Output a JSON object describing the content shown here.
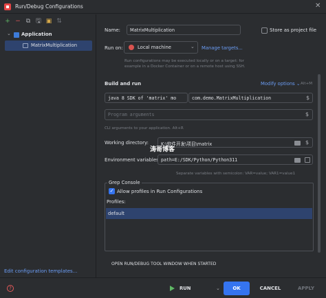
{
  "window": {
    "title": "Run/Debug Configurations",
    "close_glyph": "✕"
  },
  "toolbar": {
    "add": "+",
    "remove": "−",
    "copy": "⧉",
    "save": "🖫",
    "folder": "▣",
    "sort": "⇅"
  },
  "tree": {
    "group_label": "Application",
    "child_label": "MatrixMultiplication"
  },
  "left_footer": {
    "edit_templates": "Edit configuration templates..."
  },
  "form": {
    "name_label": "Name:",
    "name_value": "MatrixMultiplication",
    "store_as_file": "Store as project file",
    "run_on_label": "Run on:",
    "run_on_value": "Local machine",
    "manage_targets": "Manage targets...",
    "run_on_hint_1": "Run configurations may be executed locally or on a target: for",
    "run_on_hint_2": "example in a Docker Container or on a remote host using SSH.",
    "build_and_run": "Build and run",
    "modify_options": "Modify options ⌄",
    "modify_shortcut": "Alt+M",
    "jdk_value": "java 8 SDK of 'matrix' mo",
    "main_class": "com.demo.MatrixMultiplication",
    "program_args_placeholder": "Program arguments",
    "cli_hint": "CLI arguments to your application. Alt+R",
    "working_dir_label": "Working directory:",
    "working_dir_value": "K:\\软件开发\\项目\\matrix",
    "env_label": "Environment variables:",
    "env_value": "path=E:/SDK/Python/Python311",
    "env_hint": "Separate variables with semicolon: VAR=value; VAR1=value1",
    "grep_console": "Grep Console",
    "allow_profiles": "Allow profiles in Run Configurations",
    "profiles_label": "Profiles:",
    "profile_default": "default",
    "open_tool_window": "OPEN RUN/DEBUG TOOL WINDOW WHEN STARTED"
  },
  "watermark": "涛哥博客",
  "buttons": {
    "help": "?",
    "run": "RUN",
    "ok": "OK",
    "cancel": "CANCEL",
    "apply": "APPLY"
  },
  "colors": {
    "accent": "#3574f0",
    "link": "#6b9df5",
    "selection": "#2e436e",
    "background": "#2b2d30"
  },
  "icons": {
    "run": "play-icon",
    "machine": "local-machine-icon",
    "folder": "folder-icon",
    "help": "help-icon",
    "app": "application-icon"
  }
}
